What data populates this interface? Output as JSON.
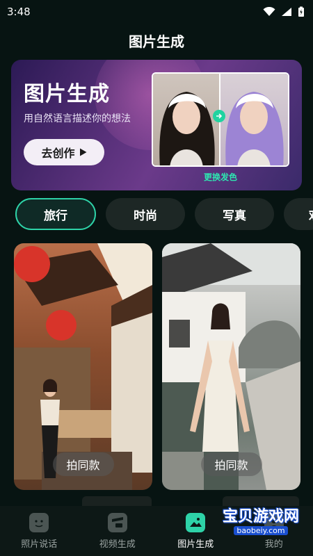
{
  "status_bar": {
    "time": "3:48"
  },
  "header": {
    "title": "图片生成"
  },
  "banner": {
    "title": "图片生成",
    "subtitle": "用自然语言描述你的想法",
    "cta_label": "去创作",
    "compare_caption": "更换发色"
  },
  "tabs": [
    {
      "label": "旅行",
      "active": true
    },
    {
      "label": "时尚",
      "active": false
    },
    {
      "label": "写真",
      "active": false
    },
    {
      "label": "欢",
      "active": false
    }
  ],
  "cards": [
    {
      "button_label": "拍同款"
    },
    {
      "button_label": "拍同款"
    }
  ],
  "bottom_nav": [
    {
      "label": "照片说话",
      "icon": "face-card-icon",
      "active": false
    },
    {
      "label": "视频生成",
      "icon": "video-clapper-icon",
      "active": false
    },
    {
      "label": "图片生成",
      "icon": "image-gen-icon",
      "active": true
    },
    {
      "label": "我的",
      "icon": "profile-icon",
      "active": false
    }
  ],
  "watermark": {
    "main": "宝贝游戏网",
    "sub": "baobeiy.com"
  },
  "colors": {
    "accent": "#2ed3a8",
    "background": "#071412"
  }
}
